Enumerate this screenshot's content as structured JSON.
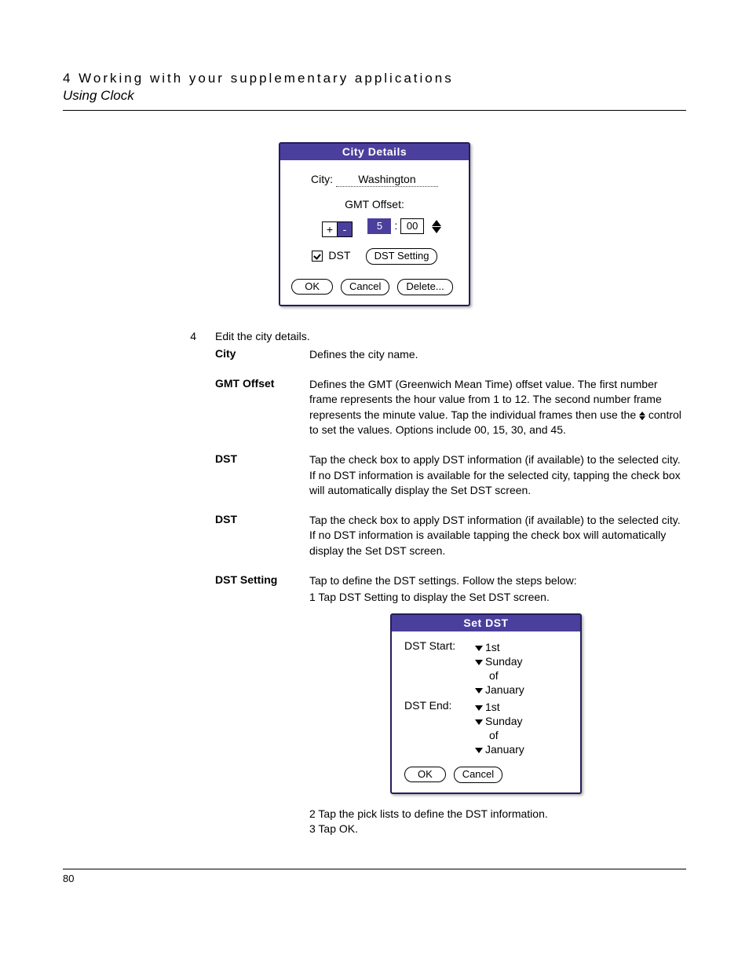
{
  "header": {
    "chapter": "4 Working with your supplementary applications",
    "section": "Using Clock"
  },
  "cityDetails": {
    "title": "City Details",
    "cityLabel": "City:",
    "cityValue": "Washington",
    "gmtLabel": "GMT Offset:",
    "plus": "+",
    "minus": "-",
    "hour": "5",
    "colon": ":",
    "minute": "00",
    "dstLabel": "DST",
    "dstSettingBtn": "DST Setting",
    "okBtn": "OK",
    "cancelBtn": "Cancel",
    "deleteBtn": "Delete..."
  },
  "step": {
    "num": "4",
    "text": "Edit the city details."
  },
  "defs": {
    "city": {
      "term": "City",
      "desc": "Defines the city name."
    },
    "gmt": {
      "term": "GMT Offset",
      "desc1": "Defines the GMT (Greenwich Mean Time) offset value. The first number frame represents the hour value from 1 to 12. The second number frame represents the minute value. Tap the individual frames then use the ",
      "desc2": " control to set the values. Options include 00, 15, 30, and 45."
    },
    "dst1": {
      "term": "DST",
      "desc": "Tap the check box to apply DST information (if available) to the selected city. If no DST information is available for the selected city, tapping the check box will automatically display the Set DST screen."
    },
    "dst2": {
      "term": "DST",
      "desc": "Tap the check box to apply DST information (if available) to the selected city. If no DST information is available tapping the check box will automatically display the Set DST screen."
    },
    "dstSetting": {
      "term": "DST Setting",
      "line1": "Tap to define the DST settings. Follow the steps below:",
      "line2": "1 Tap DST Setting to display the Set DST screen.",
      "line3": "2 Tap the pick lists to define the DST information.",
      "line4": "3 Tap OK."
    }
  },
  "setDst": {
    "title": "Set DST",
    "startLabel": "DST Start:",
    "endLabel": "DST End:",
    "ordinal": "1st",
    "day": "Sunday",
    "of": "of",
    "month": "January",
    "okBtn": "OK",
    "cancelBtn": "Cancel"
  },
  "pageNumber": "80"
}
